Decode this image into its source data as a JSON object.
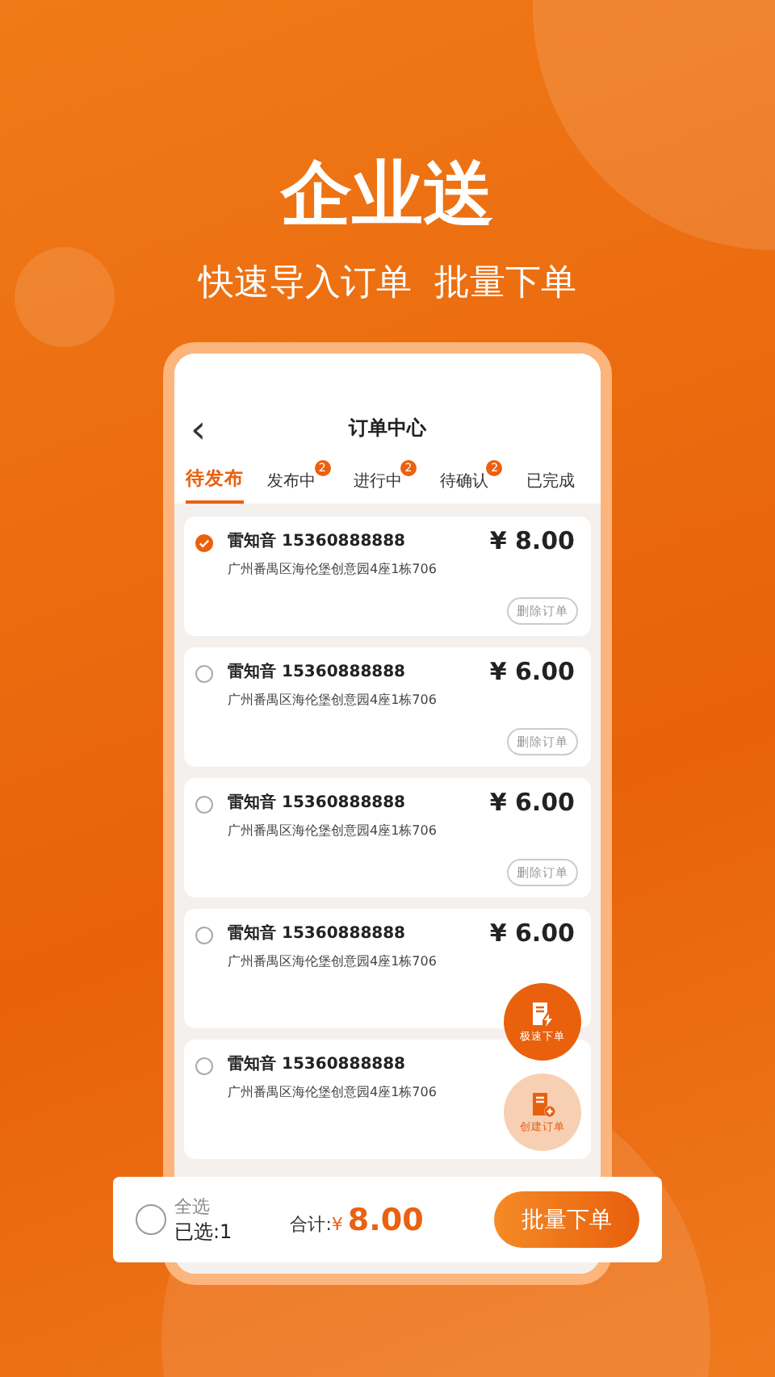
{
  "headline": "企业送",
  "subtitle": "快速导入订单  批量下单",
  "nav": {
    "back": "‹",
    "title": "订单中心"
  },
  "tabs": [
    {
      "label": "待发布",
      "selected": true
    },
    {
      "label": "发布中",
      "selected": false,
      "badge": "2"
    },
    {
      "label": "进行中",
      "selected": false,
      "badge": "2"
    },
    {
      "label": "待确认",
      "selected": false,
      "badge": "2"
    },
    {
      "label": "已完成",
      "selected": false
    }
  ],
  "orders": [
    {
      "name": "雷知音 15360888888",
      "address": "广州番禺区海伦堡创意园4座1栋706",
      "price": "¥ 8.00",
      "checked": true,
      "delete": "删除订单"
    },
    {
      "name": "雷知音 15360888888",
      "address": "广州番禺区海伦堡创意园4座1栋706",
      "price": "¥ 6.00",
      "checked": false,
      "delete": "删除订单"
    },
    {
      "name": "雷知音 15360888888",
      "address": "广州番禺区海伦堡创意园4座1栋706",
      "price": "¥ 6.00",
      "checked": false,
      "delete": "删除订单"
    },
    {
      "name": "雷知音 15360888888",
      "address": "广州番禺区海伦堡创意园4座1栋706",
      "price": "¥ 6.00",
      "checked": false
    },
    {
      "name": "雷知音 15360888888",
      "address": "广州番禺区海伦堡创意园4座1栋706",
      "checked": false
    }
  ],
  "fabs": [
    {
      "label": "极速下单",
      "kind": "quick"
    },
    {
      "label": "创建订单",
      "kind": "create"
    }
  ],
  "footer": {
    "select_all": "全选",
    "select_all_checked": false,
    "selected_count": "已选:1",
    "total_label": "合计:",
    "currency": "¥",
    "total": "8.00",
    "submit": "批量下单"
  }
}
